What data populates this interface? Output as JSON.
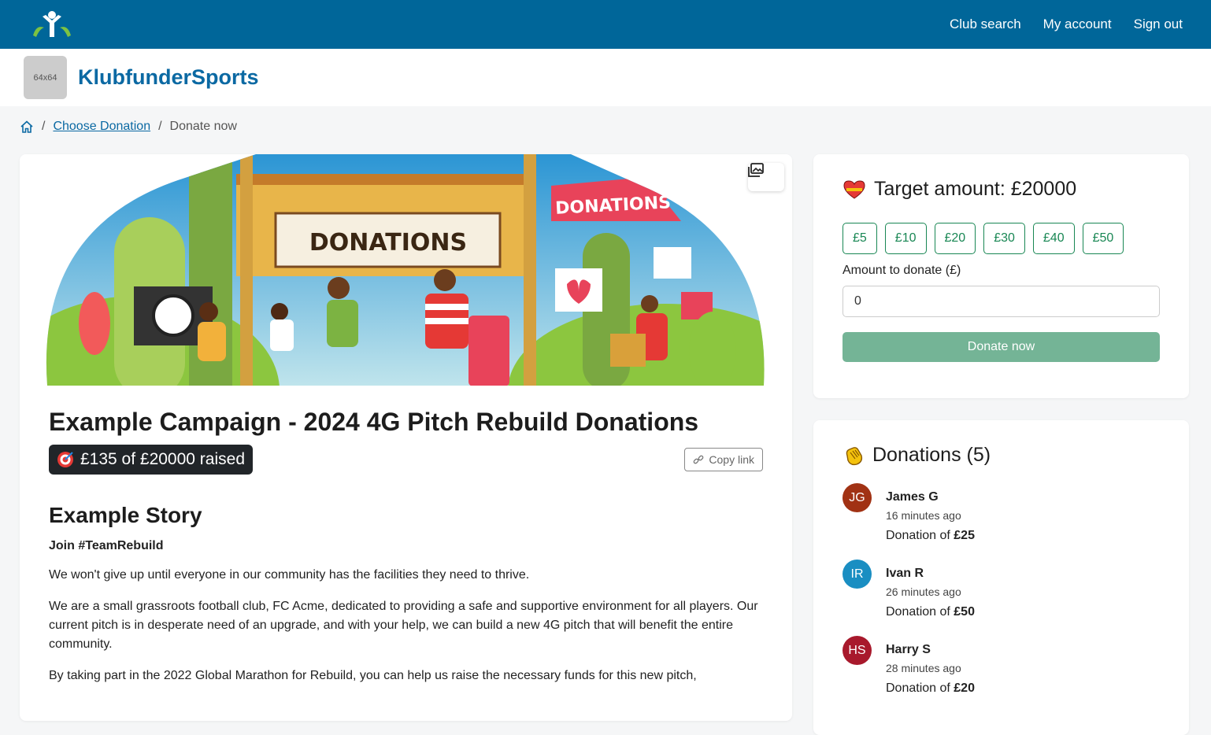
{
  "nav": {
    "club_search": "Club search",
    "my_account": "My account",
    "sign_out": "Sign out"
  },
  "brand": {
    "logo_placeholder": "64x64",
    "name": "KlubfunderSports"
  },
  "breadcrumb": {
    "choose_donation": "Choose Donation",
    "current": "Donate now"
  },
  "hero": {
    "banner_text": "DONATIONS",
    "flag_text": "DONATIONS"
  },
  "campaign": {
    "title": "Example Campaign - 2024 4G Pitch Rebuild Donations",
    "raised": "£135 of £20000 raised",
    "copy_link": "Copy link",
    "story_title": "Example Story",
    "story_subtitle": "Join #TeamRebuild",
    "paragraphs": [
      "We won't give up until everyone in our community has the facilities they need to thrive.",
      "We are a small grassroots football club, FC Acme, dedicated to providing a safe and supportive environment for all players. Our current pitch is in desperate need of an upgrade, and with your help, we can build a new 4G pitch that will benefit the entire community.",
      "By taking part in the 2022 Global Marathon for Rebuild, you can help us raise the necessary funds for this new pitch,"
    ]
  },
  "target": {
    "title": "Target amount: £20000",
    "amounts": [
      "£5",
      "£10",
      "£20",
      "£30",
      "£40",
      "£50"
    ],
    "amount_label": "Amount to donate (£)",
    "amount_value": "0",
    "donate_button": "Donate now"
  },
  "donations": {
    "title": "Donations (5)",
    "list": [
      {
        "initials": "JG",
        "name": "James G",
        "time": "16 minutes ago",
        "prefix": "Donation of ",
        "amount": "£25",
        "color": "#a13214"
      },
      {
        "initials": "IR",
        "name": "Ivan R",
        "time": "26 minutes ago",
        "prefix": "Donation of ",
        "amount": "£50",
        "color": "#1a8ec2"
      },
      {
        "initials": "HS",
        "name": "Harry S",
        "time": "28 minutes ago",
        "prefix": "Donation of ",
        "amount": "£20",
        "color": "#a8192c"
      }
    ]
  },
  "colors": {
    "nav": "#006699",
    "brand_text": "#0b69a3",
    "success": "#198754",
    "donate_button": "#74b496"
  }
}
